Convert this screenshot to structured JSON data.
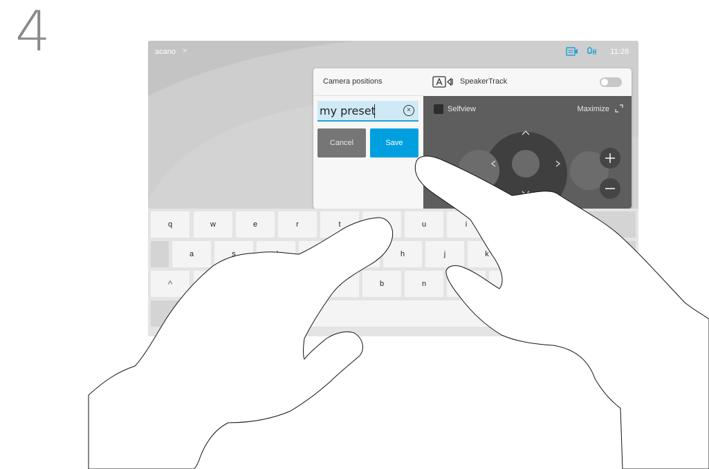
{
  "step": {
    "number": "4"
  },
  "status_bar": {
    "site_name": "acano",
    "chevron": ">",
    "time": "11:28"
  },
  "camera_positions": {
    "title": "Camera positions",
    "preset_name_value": "my preset",
    "clear_glyph": "×",
    "cancel_label": "Cancel",
    "save_label": "Save"
  },
  "camera_control": {
    "speakertrack_label": "SpeakerTrack",
    "speakertrack_on": false,
    "selfview_label": "Selfview",
    "maximize_label": "Maximize",
    "pad_glyphs": {
      "up": "^",
      "down": "v",
      "left": "<",
      "right": ">"
    },
    "zoom_in_glyph": "+",
    "zoom_out_glyph": "−"
  },
  "keyboard": {
    "row1": [
      "q",
      "w",
      "e",
      "r",
      "t",
      "",
      "u",
      "i",
      "",
      ""
    ],
    "row2": [
      "a",
      "s",
      "d",
      "",
      "",
      "h",
      "j",
      "k",
      ""
    ],
    "row3": [
      "^",
      "",
      "",
      "v",
      "b",
      "n",
      "",
      ""
    ]
  },
  "colors": {
    "accent": "#00a0e0",
    "input_highlight": "#cfe9f7",
    "cancel": "#767676",
    "camera_bg": "#5e5e5e",
    "step_number": "#8a8a8a"
  }
}
